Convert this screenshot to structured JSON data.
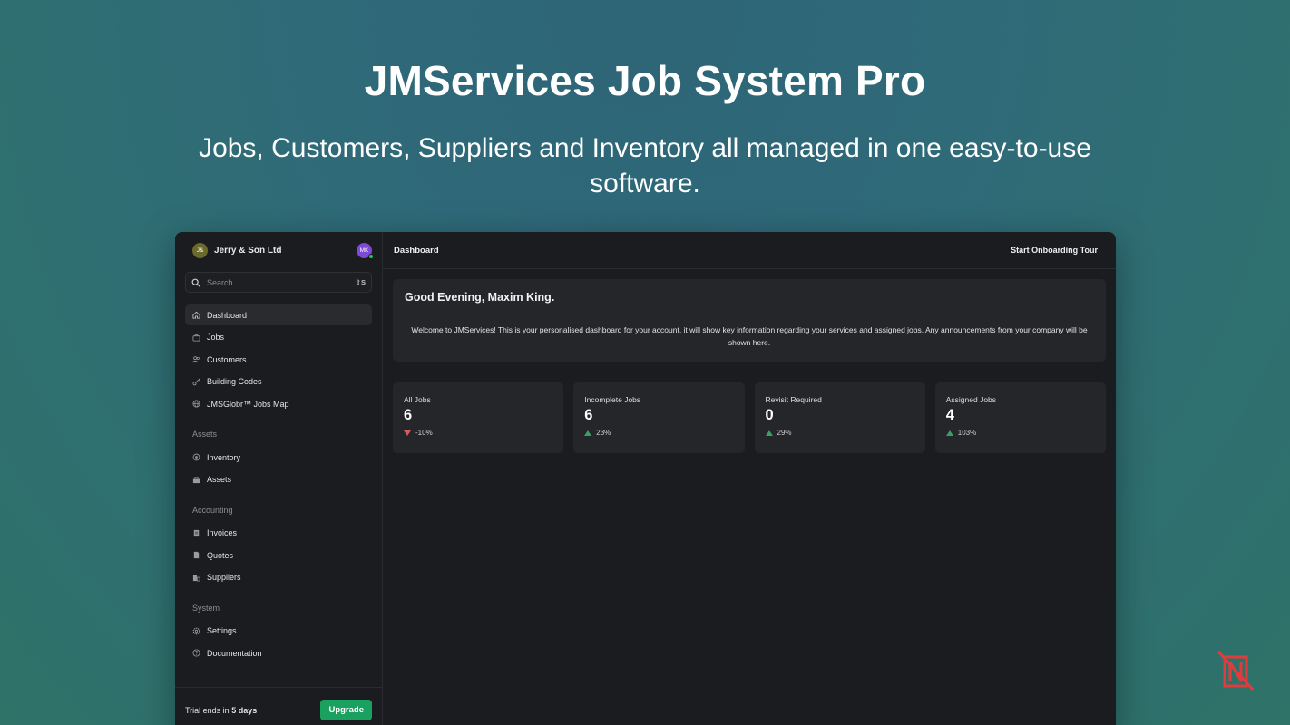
{
  "hero": {
    "title": "JMServices Job System Pro",
    "subtitle": "Jobs, Customers, Suppliers and Inventory all managed in one easy-to-use software."
  },
  "sidebar": {
    "org_initials": "J&",
    "org_name": "Jerry & Son Ltd",
    "user_initials": "MK",
    "search_placeholder": "Search",
    "search_shortcut": "⇧S",
    "main_items": [
      {
        "label": "Dashboard",
        "icon": "home-icon",
        "active": true
      },
      {
        "label": "Jobs",
        "icon": "briefcase-icon"
      },
      {
        "label": "Customers",
        "icon": "users-icon"
      },
      {
        "label": "Building Codes",
        "icon": "key-icon"
      },
      {
        "label": "JMSGlobr™ Jobs Map",
        "icon": "globe-icon"
      }
    ],
    "sections": [
      {
        "label": "Assets",
        "items": [
          {
            "label": "Inventory",
            "icon": "box-icon"
          },
          {
            "label": "Assets",
            "icon": "toolbox-icon"
          }
        ]
      },
      {
        "label": "Accounting",
        "items": [
          {
            "label": "Invoices",
            "icon": "invoice-icon"
          },
          {
            "label": "Quotes",
            "icon": "quote-icon"
          },
          {
            "label": "Suppliers",
            "icon": "building-icon"
          }
        ]
      },
      {
        "label": "System",
        "items": [
          {
            "label": "Settings",
            "icon": "gear-icon"
          },
          {
            "label": "Documentation",
            "icon": "help-icon"
          }
        ]
      }
    ],
    "trial_prefix": "Trial ends in ",
    "trial_days": "5 days",
    "upgrade_label": "Upgrade"
  },
  "topbar": {
    "title": "Dashboard",
    "tour_label": "Start Onboarding Tour"
  },
  "welcome": {
    "greeting": "Good Evening, Maxim King.",
    "body": "Welcome to JMServices! This is your personalised dashboard for your account, it will show key information regarding your services and assigned jobs. Any announcements from your company will be shown here."
  },
  "stats": [
    {
      "label": "All Jobs",
      "value": "6",
      "change": "-10%",
      "direction": "down"
    },
    {
      "label": "Incomplete Jobs",
      "value": "6",
      "change": "23%",
      "direction": "up"
    },
    {
      "label": "Revisit Required",
      "value": "0",
      "change": "29%",
      "direction": "up"
    },
    {
      "label": "Assigned Jobs",
      "value": "4",
      "change": "103%",
      "direction": "up"
    }
  ],
  "colors": {
    "accent_green": "#1aa160",
    "up": "#36a269",
    "down": "#d65c5c",
    "chat": "#0b3a8f"
  }
}
